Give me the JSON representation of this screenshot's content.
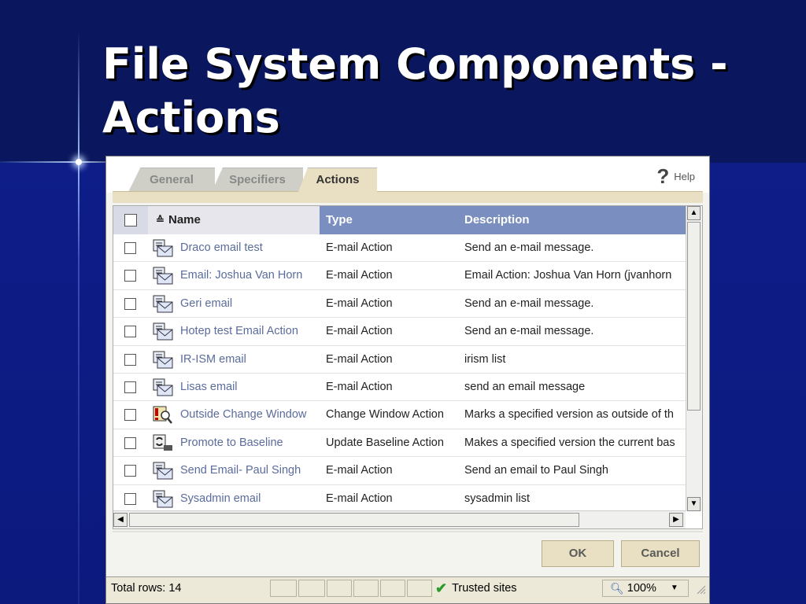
{
  "slide": {
    "title_line1": "File System Components -",
    "title_line2": "Actions"
  },
  "tabs": {
    "general": "General",
    "specifiers": "Specifiers",
    "actions": "Actions",
    "help": "Help"
  },
  "table": {
    "columns": {
      "name": "Name",
      "type": "Type",
      "description": "Description"
    },
    "rows": [
      {
        "name": "Draco email test",
        "type": "E-mail Action",
        "description": "Send an e-mail message.",
        "icon": "email-action-icon"
      },
      {
        "name": "Email: Joshua Van Horn",
        "type": "E-mail Action",
        "description": "Email Action: Joshua Van Horn (jvanhorn",
        "icon": "email-action-icon"
      },
      {
        "name": "Geri email",
        "type": "E-mail Action",
        "description": "Send an e-mail message.",
        "icon": "email-action-icon"
      },
      {
        "name": "Hotep test Email Action",
        "type": "E-mail Action",
        "description": "Send an e-mail message.",
        "icon": "email-action-icon"
      },
      {
        "name": "IR-ISM email",
        "type": "E-mail Action",
        "description": "irism list",
        "icon": "email-action-icon"
      },
      {
        "name": "Lisas email",
        "type": "E-mail Action",
        "description": "send an email message",
        "icon": "email-action-icon"
      },
      {
        "name": "Outside Change Window",
        "type": "Change Window Action",
        "description": "Marks a specified version as outside of th",
        "icon": "change-window-icon"
      },
      {
        "name": "Promote to Baseline",
        "type": "Update Baseline Action",
        "description": "Makes a specified version the current bas",
        "icon": "baseline-icon"
      },
      {
        "name": "Send Email- Paul Singh",
        "type": "E-mail Action",
        "description": "Send an email to Paul Singh",
        "icon": "email-action-icon"
      },
      {
        "name": "Sysadmin email",
        "type": "E-mail Action",
        "description": "sysadmin list",
        "icon": "email-action-icon"
      }
    ]
  },
  "buttons": {
    "ok": "OK",
    "cancel": "Cancel"
  },
  "status": {
    "total_rows": "Total rows: 14",
    "zone": "Trusted sites",
    "zoom": "100%"
  },
  "colors": {
    "slide_bg": "#0e1e8c",
    "header_bg": "#7a8fbf",
    "link_text": "#5b6c9c",
    "button_bg": "#e9dfc3"
  }
}
